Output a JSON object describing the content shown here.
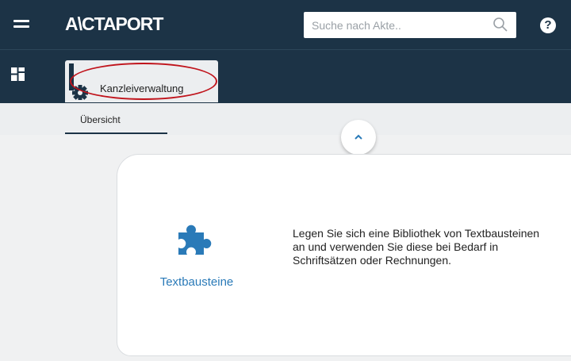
{
  "app": {
    "logo": "A\\CTAPORT",
    "menu_icon": "hamburger-icon",
    "help_label": "?"
  },
  "search": {
    "placeholder": "Suche nach Akte..",
    "value": "",
    "icon": "search-icon"
  },
  "navigation": {
    "module_switch_icon": "grid-icon",
    "active_tab": {
      "label": "Kanzleiverwaltung",
      "icon": "gear-icon"
    },
    "subtabs": [
      {
        "label": "Übersicht"
      }
    ],
    "collapse_icon": "chevron-up-icon"
  },
  "content": {
    "tiles": [
      {
        "label": "Textbausteine",
        "icon": "puzzle-icon",
        "description": "Legen Sie sich eine Bibliothek von Textbausteinen an und verwenden Sie diese bei Bedarf in Schriftsätzen oder Rechnungen."
      }
    ]
  },
  "colors": {
    "header": "#1c3346",
    "accent": "#2a7ab8",
    "annotation": "#c0141c"
  }
}
